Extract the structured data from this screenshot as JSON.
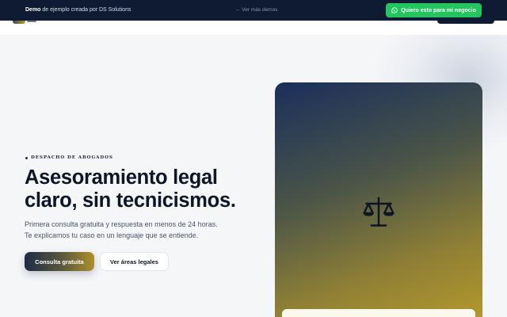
{
  "demo_bar": {
    "brand": "Demo",
    "text": "de ejemplo creada por DS Solutions",
    "back_link": "← Ver más demos",
    "cta": "Quiero esto para mi negocio",
    "cta_icon": "whatsapp-icon",
    "cta_color": "#22c55e"
  },
  "hero": {
    "eyebrow": "DESPACHO DE ABOGADOS",
    "headline_line1": "Asesoramiento legal",
    "headline_line2": "claro, sin tecnicismos.",
    "subtitle": "Primera consulta gratuita y respuesta en menos de 24 horas. Te explicamos tu caso en un lenguaje que se entiende.",
    "primary_button": "Consulta gratuita",
    "secondary_button": "Ver áreas legales"
  },
  "card": {
    "icon": "scales-of-justice-icon"
  },
  "colors": {
    "navy": "#0f1b33",
    "gold": "#b79a2c",
    "background": "#f5f6f8"
  }
}
